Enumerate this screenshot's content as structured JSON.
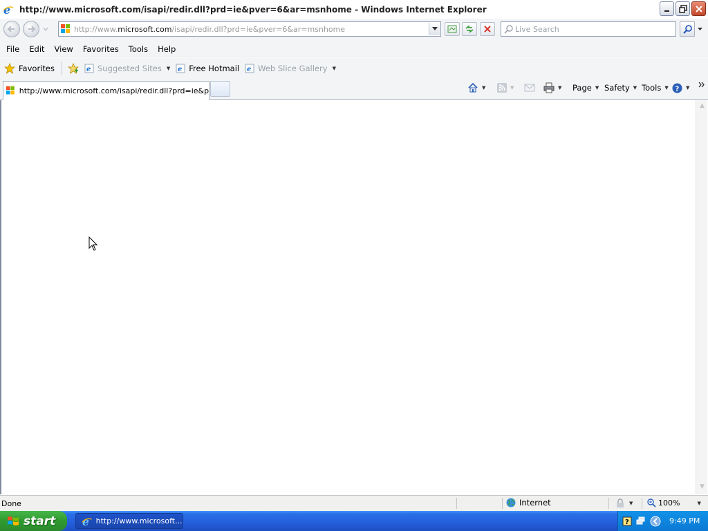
{
  "window": {
    "title": "http://www.microsoft.com/isapi/redir.dll?prd=ie&pver=6&ar=msnhome - Windows Internet Explorer"
  },
  "address": {
    "url_prefix": "http://www.",
    "url_domain": "microsoft.com",
    "url_rest": "/isapi/redir.dll?prd=ie&pver=6&ar=msnhome"
  },
  "search": {
    "placeholder": "Live Search"
  },
  "menu": [
    "File",
    "Edit",
    "View",
    "Favorites",
    "Tools",
    "Help"
  ],
  "favorites_bar": {
    "favorites_label": "Favorites",
    "items": [
      {
        "label": "Suggested Sites",
        "dim": true,
        "has_dropdown": true
      },
      {
        "label": "Free Hotmail",
        "dim": false,
        "has_dropdown": false
      },
      {
        "label": "Web Slice Gallery",
        "dim": true,
        "has_dropdown": true
      }
    ]
  },
  "tab": {
    "label": "http://www.microsoft.com/isapi/redir.dll?prd=ie&pver..."
  },
  "command_bar": {
    "page": "Page",
    "safety": "Safety",
    "tools": "Tools"
  },
  "status": {
    "text": "Done",
    "zone": "Internet",
    "zoom": "100%"
  },
  "taskbar": {
    "start_label": "start",
    "task_label": "http://www.microsoft....",
    "clock": "9:49 PM"
  },
  "colors": {
    "taskbar_blue": "#245edb",
    "start_green": "#2f9a2f",
    "tray_blue": "#0b78d4",
    "close_red": "#c24a2c"
  }
}
